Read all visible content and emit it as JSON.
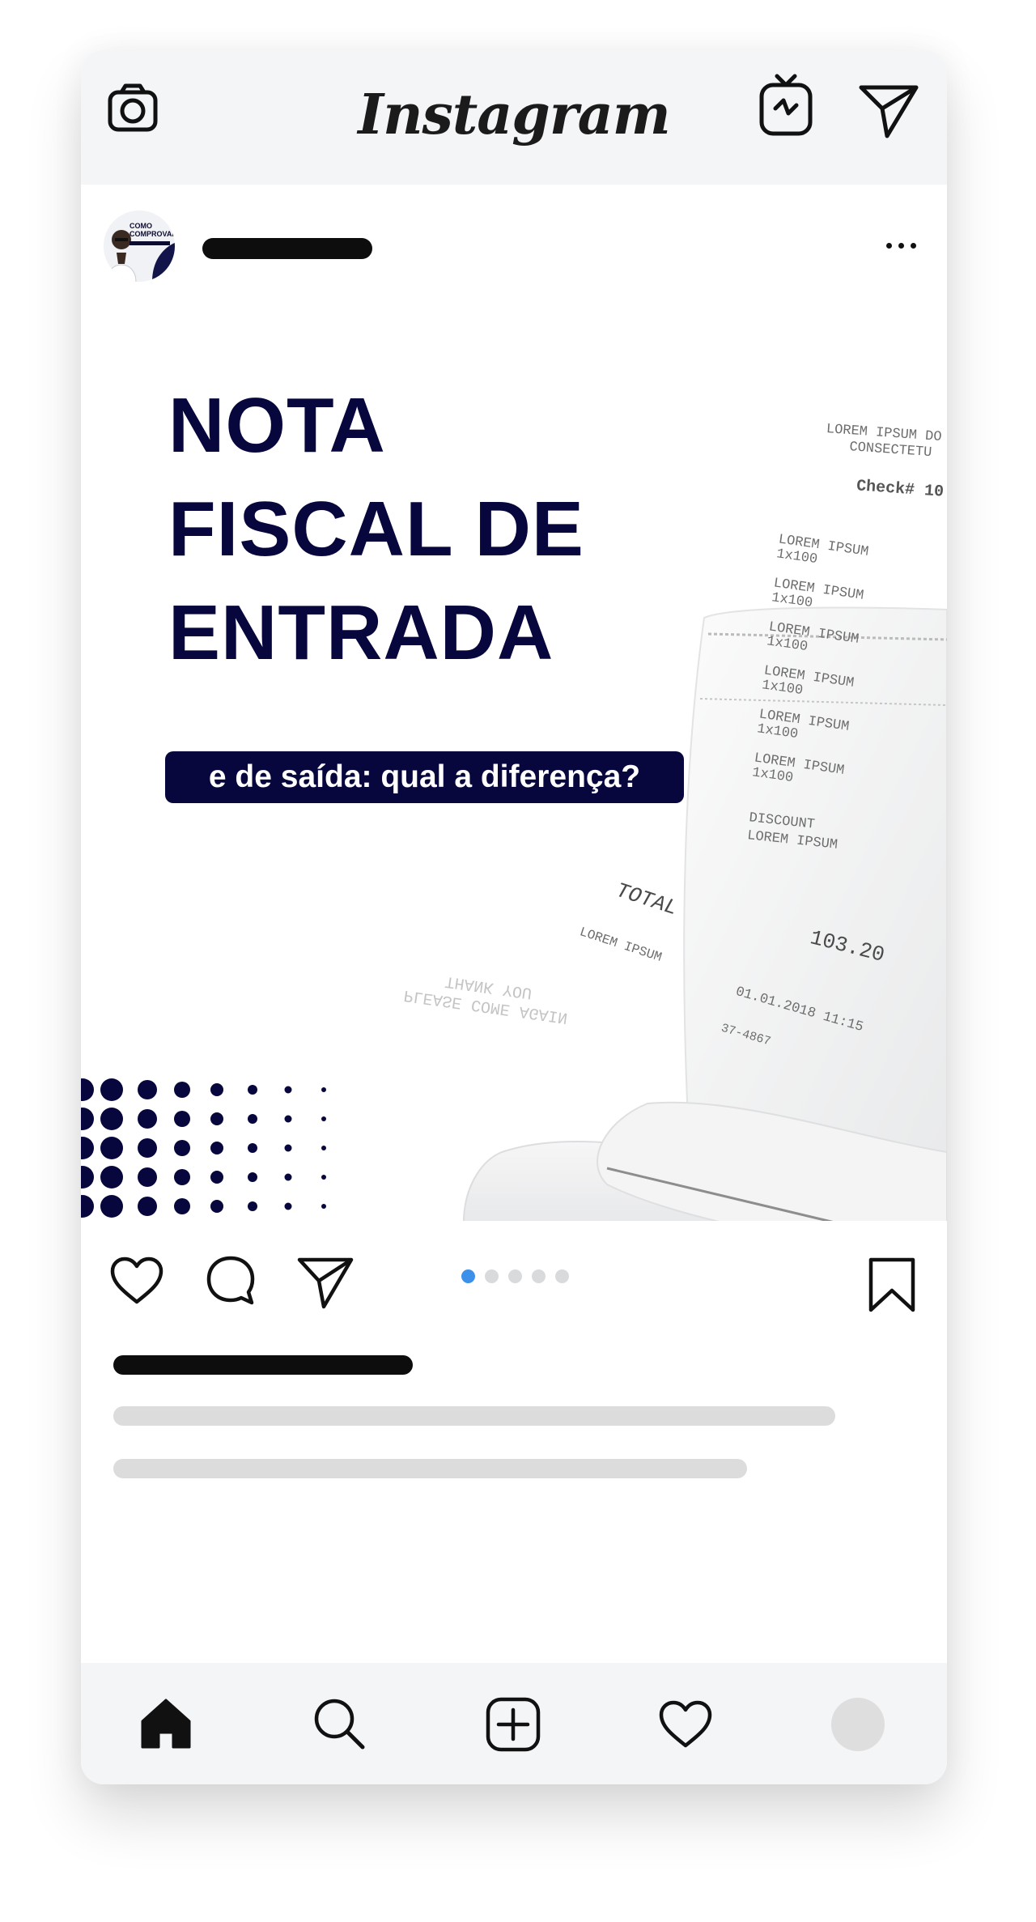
{
  "app": {
    "title": "Instagram"
  },
  "top_bar": {
    "camera_icon": "camera-icon",
    "igtv_icon": "igtv-icon",
    "direct_icon": "paper-plane-icon"
  },
  "post": {
    "avatar": {
      "text_lines": [
        "COMO",
        "COMPROVAR"
      ],
      "label_hidden": "username placeholder"
    },
    "image": {
      "headline_lines": [
        "NOTA",
        "FISCAL DE",
        "ENTRADA"
      ],
      "subtitle": "e de saída: qual a diferença?",
      "receipt": {
        "header_lines": [
          "LOREM IPSUM DO",
          "CONSECTETU"
        ],
        "check": "Check# 10",
        "items": [
          "LOREM IPSUM",
          "1x100",
          "LOREM IPSUM",
          "1x100",
          "LOREM IPSUM",
          "1x100",
          "LOREM IPSUM",
          "1x100",
          "LOREM IPSUM",
          "1x100",
          "LOREM IPSUM",
          "1x100"
        ],
        "discount": "DISCOUNT",
        "discount_sub": "LOREM IPSUM",
        "total_label": "TOTAL",
        "total_value": "103.20",
        "footer_left": "LOREM IPSUM",
        "date": "01.01.2018  11:15",
        "code": "37-4867",
        "thanks_mirrored": [
          "PLEASE COME AGAIN",
          "THANK YOU"
        ]
      }
    },
    "carousel": {
      "count": 5,
      "active_index": 0
    },
    "colors": {
      "headline": "#07073d",
      "active_dot": "#3d90ea",
      "inactive_dot": "#d9dadc"
    }
  },
  "bottom_nav": {
    "items": [
      "home-icon",
      "search-icon",
      "add-post-icon",
      "heart-icon",
      "profile-avatar"
    ]
  }
}
